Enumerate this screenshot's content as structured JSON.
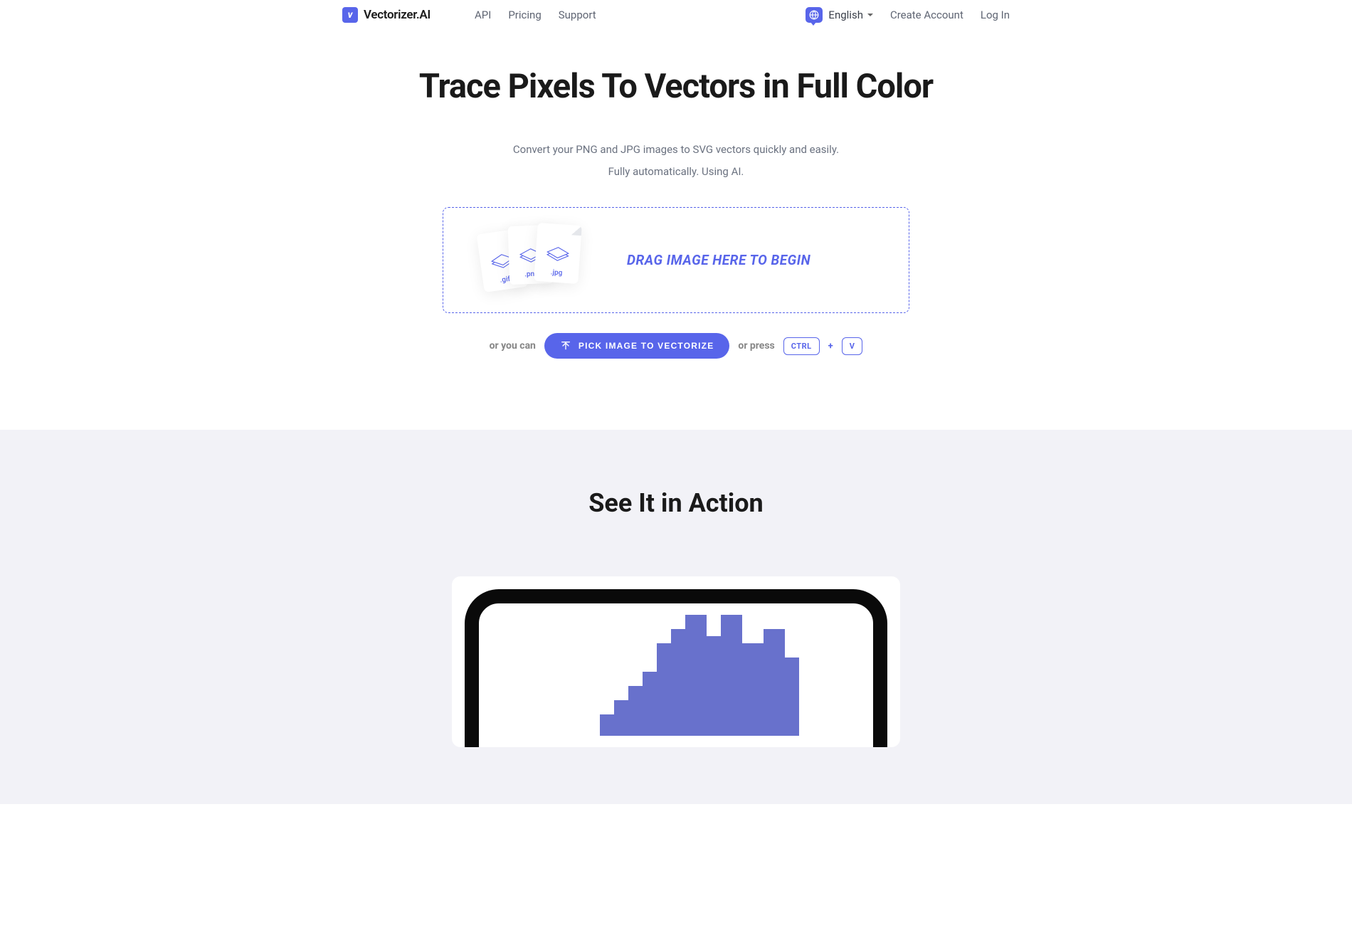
{
  "header": {
    "brand": "Vectorizer.AI",
    "nav": {
      "api": "API",
      "pricing": "Pricing",
      "support": "Support"
    },
    "language": "English",
    "create_account": "Create Account",
    "login": "Log In"
  },
  "hero": {
    "title": "Trace Pixels To Vectors in Full Color",
    "subtitle_line1": "Convert your PNG and JPG images to SVG vectors quickly and easily.",
    "subtitle_line2": "Fully automatically. Using AI."
  },
  "dropzone": {
    "file_exts": {
      "gif": ".gif",
      "png": ".png",
      "jpg": ".jpg"
    },
    "text": "DRAG IMAGE HERE TO BEGIN"
  },
  "actions": {
    "or_you_can": "or you can",
    "pick_button": "PICK IMAGE TO VECTORIZE",
    "or_press": "or press",
    "key_ctrl": "CTRL",
    "key_plus": "+",
    "key_v": "V"
  },
  "section2": {
    "title": "See It in Action"
  }
}
